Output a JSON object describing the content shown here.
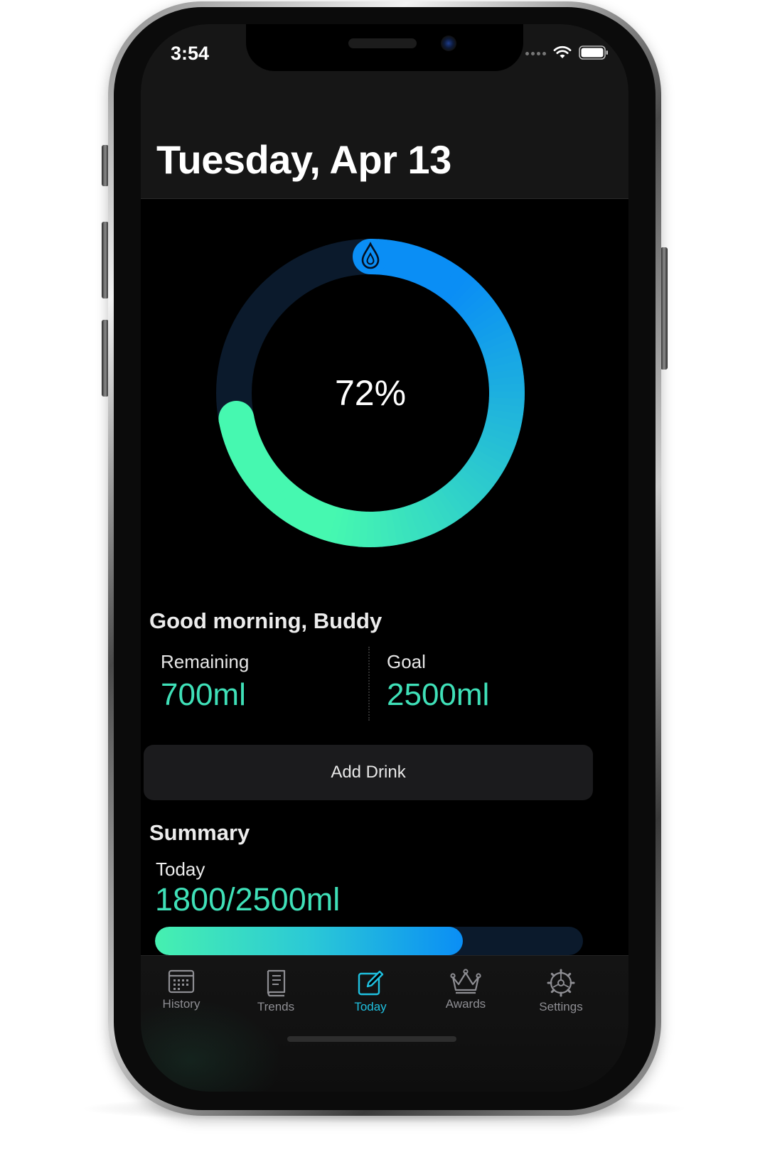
{
  "status_bar": {
    "time": "3:54"
  },
  "header": {
    "title": "Tuesday, Apr 13"
  },
  "progress_ring": {
    "percent_label": "72%",
    "fraction": 0.72
  },
  "greeting": "Good morning, Buddy",
  "stats": {
    "remaining_label": "Remaining",
    "remaining_value": "700ml",
    "goal_label": "Goal",
    "goal_value": "2500ml"
  },
  "actions": {
    "add_drink_label": "Add Drink"
  },
  "summary": {
    "title": "Summary",
    "today_label": "Today",
    "today_value": "1800/2500ml",
    "progress_fraction": 0.72
  },
  "tabs": [
    {
      "label": "History",
      "icon": "calendar-icon"
    },
    {
      "label": "Trends",
      "icon": "book-icon"
    },
    {
      "label": "Today",
      "icon": "edit-icon",
      "active": true
    },
    {
      "label": "Awards",
      "icon": "crown-icon"
    },
    {
      "label": "Settings",
      "icon": "gear-icon"
    }
  ],
  "colors": {
    "accent": "#1fc1e0",
    "value_green": "#3fe0b8",
    "ring_start": "#46f8b0",
    "ring_end": "#0a8ef5",
    "track": "#0b1a2c"
  }
}
